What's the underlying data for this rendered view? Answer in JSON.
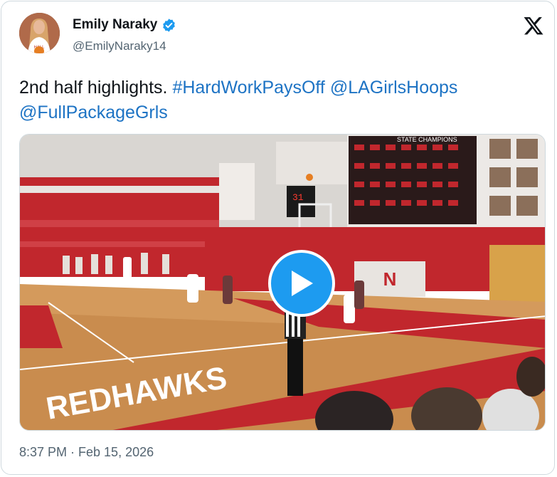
{
  "author": {
    "name": "Emily Naraky",
    "handle": "@EmilyNaraky14",
    "verified": true,
    "avatar_icon": "avatar-photo"
  },
  "tweet": {
    "text_plain": "2nd half highlights. ",
    "hashtag": "#HardWorkPaysOff",
    "mention_1": "@LAGirlsHoops",
    "mention_2": "@FullPackageGrls",
    "timestamp": "8:37 PM · Feb 15, 2026"
  },
  "media": {
    "type": "video",
    "floor_text": "REDHAWKS",
    "banner_text": "STATE CHAMPIONS",
    "scoreboard_digits": "31",
    "play_icon": "play-icon"
  },
  "icons": {
    "platform": "x-logo-icon",
    "verified": "verified-badge-icon"
  },
  "colors": {
    "link": "#1d73c4",
    "verified": "#1d9bf0",
    "play_button": "#1d9bf0",
    "secondary_text": "#536471",
    "border": "#cfd9de"
  }
}
